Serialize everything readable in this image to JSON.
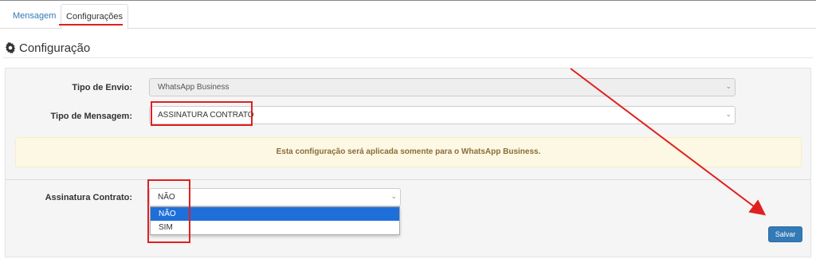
{
  "tabs": [
    {
      "label": "Mensagem",
      "active": false
    },
    {
      "label": "Configurações",
      "active": true
    }
  ],
  "heading": {
    "icon": "gear-icon",
    "title": "Configuração"
  },
  "form": {
    "tipo_envio": {
      "label": "Tipo de Envio:",
      "value": "WhatsApp Business",
      "disabled": true
    },
    "tipo_mensagem": {
      "label": "Tipo de Mensagem:",
      "value": "ASSINATURA CONTRATO"
    },
    "alert": "Esta configuração será aplicada somente para o WhatsApp Business.",
    "assinatura": {
      "label": "Assinatura Contrato:",
      "value": "NÃO",
      "options": [
        "NÃO",
        "SIM"
      ],
      "highlighted_option": "NÃO"
    }
  },
  "actions": {
    "save_label": "Salvar"
  },
  "colors": {
    "accent": "#337ab7",
    "annotation": "#e02020",
    "alert_bg": "#fcf8e3",
    "alert_text": "#8a6d3b",
    "highlight": "#1e6fd9"
  }
}
